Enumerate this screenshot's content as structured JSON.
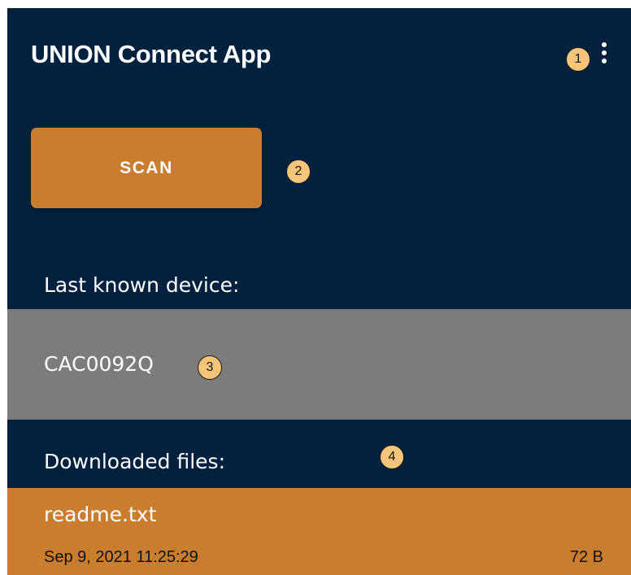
{
  "app": {
    "title": "UNION Connect App",
    "menu_icon": "more-vert-icon"
  },
  "scan_button": {
    "label": "SCAN"
  },
  "last_device": {
    "label": "Last known device:",
    "device_id": "CAC0092Q"
  },
  "downloads": {
    "label": "Downloaded files:",
    "files": [
      {
        "name": "readme.txt",
        "date": "Sep 9, 2021 11:25:29",
        "size": "72 B"
      }
    ]
  },
  "callouts": [
    "1",
    "2",
    "3",
    "4"
  ],
  "colors": {
    "background": "#02213f",
    "accent": "#c97d2e",
    "device_row": "#7c7c7c",
    "callout": "#f7c57a"
  }
}
